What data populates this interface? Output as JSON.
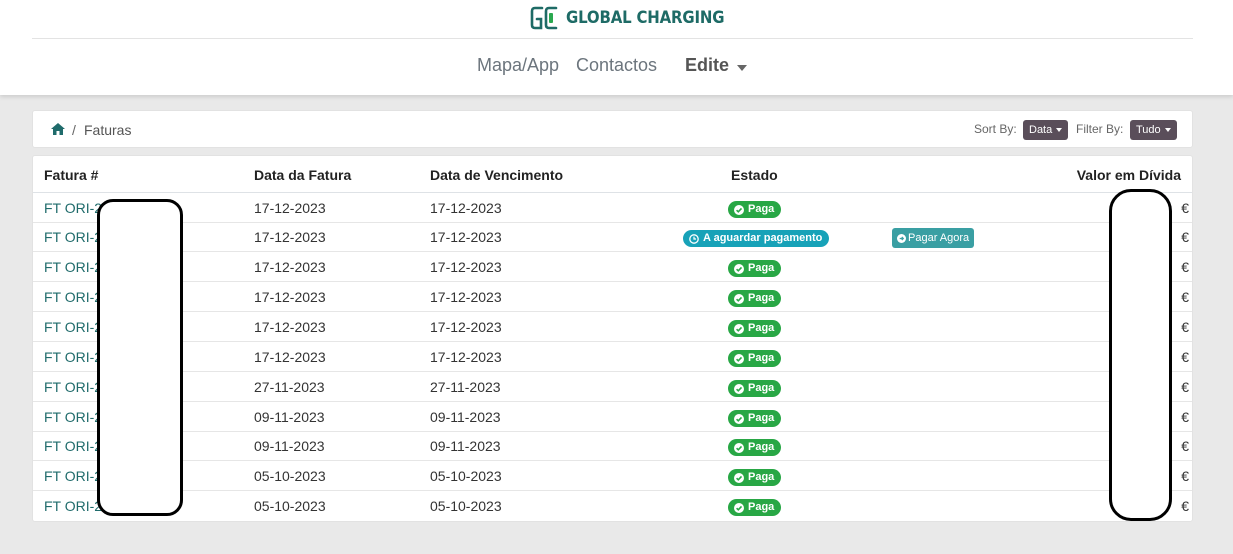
{
  "brand": {
    "name": "GLOBAL CHARGING",
    "mark_letters": "GC",
    "color": "#1e6b66",
    "accent": "#2aa84f"
  },
  "nav": {
    "items": [
      "Mapa/App",
      "Contactos"
    ],
    "edit_label": "Edite"
  },
  "breadcrumb": {
    "home_icon": "home-icon",
    "separator": "/",
    "current": "Faturas"
  },
  "controls": {
    "sort_label": "Sort By:",
    "sort_value": "Data",
    "filter_label": "Filter By:",
    "filter_value": "Tudo"
  },
  "table": {
    "headers": {
      "invoice": "Fatura #",
      "invoice_date": "Data da Fatura",
      "due_date": "Data de Vencimento",
      "status": "Estado",
      "amount": "Valor em Dívida"
    },
    "rows": [
      {
        "invoice": "FT ORI-2",
        "invoice_date": "17-12-2023",
        "due_date": "17-12-2023",
        "status": "Paga",
        "currency": "€"
      },
      {
        "invoice": "FT ORI-2",
        "invoice_date": "17-12-2023",
        "due_date": "17-12-2023",
        "status": "A aguardar pagamento",
        "action": "Pagar Agora",
        "currency": "€"
      },
      {
        "invoice": "FT ORI-2",
        "invoice_date": "17-12-2023",
        "due_date": "17-12-2023",
        "status": "Paga",
        "currency": "€"
      },
      {
        "invoice": "FT ORI-2",
        "invoice_date": "17-12-2023",
        "due_date": "17-12-2023",
        "status": "Paga",
        "currency": "€"
      },
      {
        "invoice": "FT ORI-2",
        "invoice_date": "17-12-2023",
        "due_date": "17-12-2023",
        "status": "Paga",
        "currency": "€"
      },
      {
        "invoice": "FT ORI-2",
        "invoice_date": "17-12-2023",
        "due_date": "17-12-2023",
        "status": "Paga",
        "currency": "€"
      },
      {
        "invoice": "FT ORI-2",
        "invoice_date": "27-11-2023",
        "due_date": "27-11-2023",
        "status": "Paga",
        "currency": "€"
      },
      {
        "invoice": "FT ORI-2",
        "invoice_date": "09-11-2023",
        "due_date": "09-11-2023",
        "status": "Paga",
        "currency": "€"
      },
      {
        "invoice": "FT ORI-2",
        "invoice_date": "09-11-2023",
        "due_date": "09-11-2023",
        "status": "Paga",
        "currency": "€"
      },
      {
        "invoice": "FT ORI-2",
        "invoice_date": "05-10-2023",
        "due_date": "05-10-2023",
        "status": "Paga",
        "currency": "€"
      },
      {
        "invoice": "FT ORI-2",
        "invoice_date": "05-10-2023",
        "due_date": "05-10-2023",
        "status": "Paga",
        "currency": "€"
      }
    ]
  },
  "colors": {
    "paid": "#28a745",
    "awaiting": "#17a2b8",
    "pay_button": "#3a9fa3",
    "dropdown": "#5a4e5a"
  }
}
